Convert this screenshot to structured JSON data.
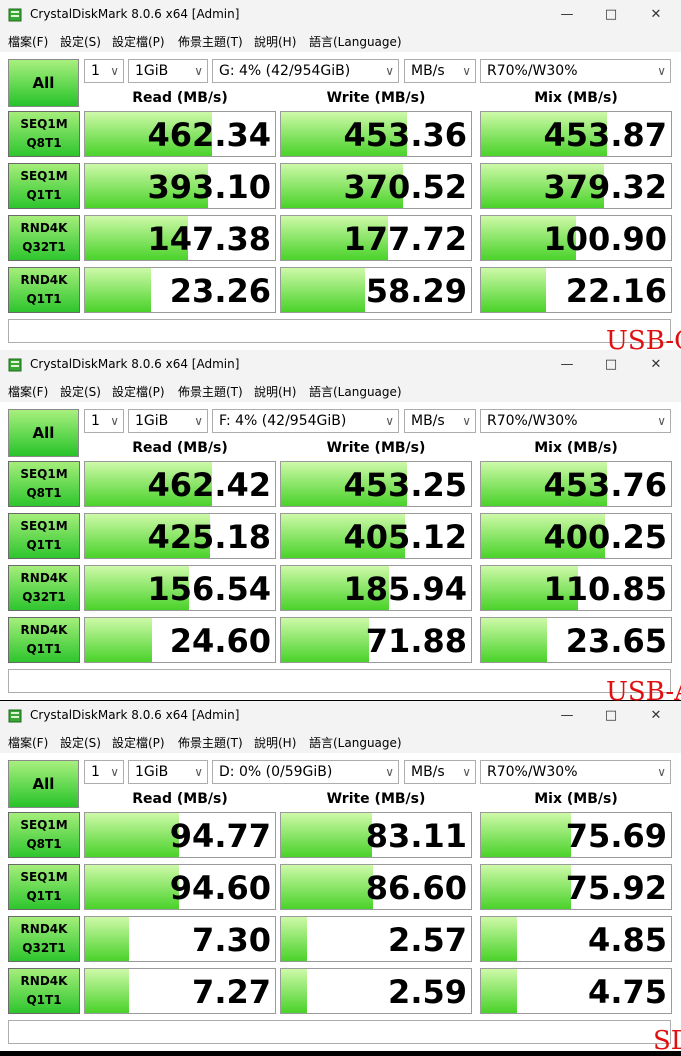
{
  "windows": [
    {
      "title": "CrystalDiskMark 8.0.6 x64 [Admin]",
      "menu": [
        "檔案(F)",
        "設定(S)",
        "設定檔(P)",
        "佈景主題(T)",
        "說明(H)",
        "語言(Language)"
      ],
      "all_label": "All",
      "count": "1",
      "size": "1GiB",
      "drive": "G: 4% (42/954GiB)",
      "unit": "MB/s",
      "mix_ratio": "R70%/W30%",
      "headers": {
        "read": "Read (MB/s)",
        "write": "Write (MB/s)",
        "mix": "Mix (MB/s)"
      },
      "tests": [
        {
          "line1": "SEQ1M",
          "line2": "Q8T1",
          "read": "462.34",
          "write": "453.36",
          "mix": "453.87"
        },
        {
          "line1": "SEQ1M",
          "line2": "Q1T1",
          "read": "393.10",
          "write": "370.52",
          "mix": "379.32"
        },
        {
          "line1": "RND4K",
          "line2": "Q32T1",
          "read": "147.38",
          "write": "177.72",
          "mix": "100.90"
        },
        {
          "line1": "RND4K",
          "line2": "Q1T1",
          "read": "23.26",
          "write": "58.29",
          "mix": "22.16"
        }
      ],
      "label": "USB-C"
    },
    {
      "title": "CrystalDiskMark 8.0.6 x64 [Admin]",
      "menu": [
        "檔案(F)",
        "設定(S)",
        "設定檔(P)",
        "佈景主題(T)",
        "說明(H)",
        "語言(Language)"
      ],
      "all_label": "All",
      "count": "1",
      "size": "1GiB",
      "drive": "F: 4% (42/954GiB)",
      "unit": "MB/s",
      "mix_ratio": "R70%/W30%",
      "headers": {
        "read": "Read (MB/s)",
        "write": "Write (MB/s)",
        "mix": "Mix (MB/s)"
      },
      "tests": [
        {
          "line1": "SEQ1M",
          "line2": "Q8T1",
          "read": "462.42",
          "write": "453.25",
          "mix": "453.76"
        },
        {
          "line1": "SEQ1M",
          "line2": "Q1T1",
          "read": "425.18",
          "write": "405.12",
          "mix": "400.25"
        },
        {
          "line1": "RND4K",
          "line2": "Q32T1",
          "read": "156.54",
          "write": "185.94",
          "mix": "110.85"
        },
        {
          "line1": "RND4K",
          "line2": "Q1T1",
          "read": "24.60",
          "write": "71.88",
          "mix": "23.65"
        }
      ],
      "label": "USB-A"
    },
    {
      "title": "CrystalDiskMark 8.0.6 x64 [Admin]",
      "menu": [
        "檔案(F)",
        "設定(S)",
        "設定檔(P)",
        "佈景主題(T)",
        "說明(H)",
        "語言(Language)"
      ],
      "all_label": "All",
      "count": "1",
      "size": "1GiB",
      "drive": "D: 0% (0/59GiB)",
      "unit": "MB/s",
      "mix_ratio": "R70%/W30%",
      "headers": {
        "read": "Read (MB/s)",
        "write": "Write (MB/s)",
        "mix": "Mix (MB/s)"
      },
      "tests": [
        {
          "line1": "SEQ1M",
          "line2": "Q8T1",
          "read": "94.77",
          "write": "83.11",
          "mix": "75.69"
        },
        {
          "line1": "SEQ1M",
          "line2": "Q1T1",
          "read": "94.60",
          "write": "86.60",
          "mix": "75.92"
        },
        {
          "line1": "RND4K",
          "line2": "Q32T1",
          "read": "7.30",
          "write": "2.57",
          "mix": "4.85"
        },
        {
          "line1": "RND4K",
          "line2": "Q1T1",
          "read": "7.27",
          "write": "2.59",
          "mix": "4.75"
        }
      ],
      "label": "SD"
    }
  ],
  "icons": {
    "minimize": "minimize-icon",
    "maximize": "maximize-icon",
    "close": "close-icon",
    "dropdown": "chevron-down-icon"
  },
  "colors": {
    "bar_green": "#4ad22a",
    "button_green": "#2ec52e",
    "label_red": "#e01010"
  }
}
